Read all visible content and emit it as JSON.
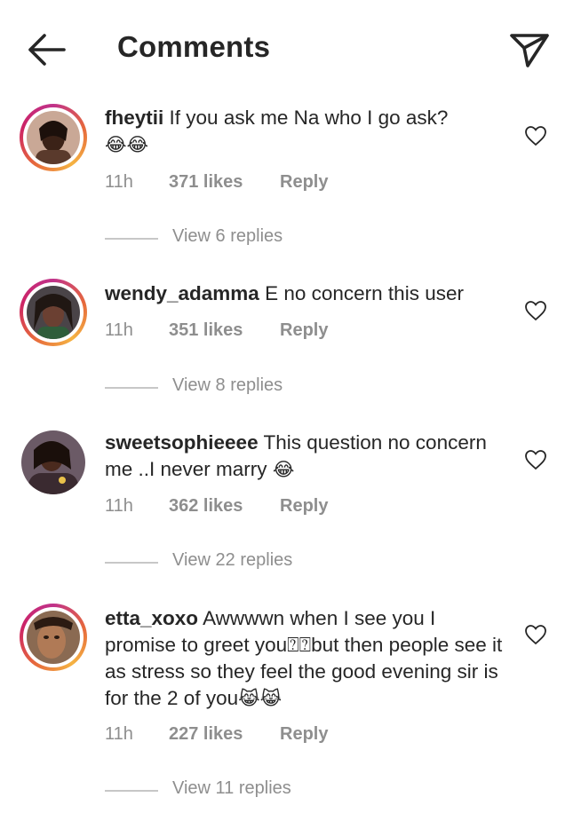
{
  "header": {
    "title": "Comments",
    "back_icon": "arrow-left-icon",
    "share_icon": "paper-plane-icon"
  },
  "comments": [
    {
      "username": "fheytii",
      "text": "If you ask me Na who I go ask?",
      "emoji": "😂😂",
      "time": "11h",
      "likes": "371 likes",
      "reply": "Reply",
      "view_replies": "View 6 replies",
      "has_story": true
    },
    {
      "username": "wendy_adamma",
      "text": "E no concern this user",
      "emoji": "",
      "time": "11h",
      "likes": "351 likes",
      "reply": "Reply",
      "view_replies": "View 8 replies",
      "has_story": true
    },
    {
      "username": "sweetsophieeee",
      "text": "This question no concern me ..I never marry",
      "emoji": "😂",
      "time": "11h",
      "likes": "362 likes",
      "reply": "Reply",
      "view_replies": "View 22 replies",
      "has_story": false
    },
    {
      "username": "etta_xoxo",
      "text": "Awwwwn when I see you I promise to greet you⍰⍰but then people see it as stress so they feel the good evening sir is for the 2 of you",
      "emoji": "😹😹",
      "time": "11h",
      "likes": "227 likes",
      "reply": "Reply",
      "view_replies": "View 11 replies",
      "has_story": true
    }
  ],
  "colors": {
    "text": "#262626",
    "secondary": "#8e8e8e",
    "divider": "#c7c7c7",
    "story_ring": "#c0328a"
  },
  "icons": {
    "like": "heart-outline-icon"
  }
}
